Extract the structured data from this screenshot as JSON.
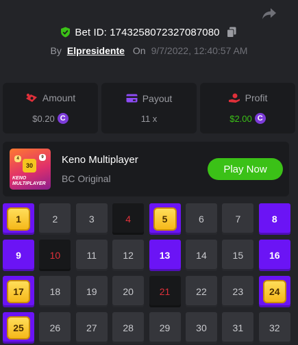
{
  "header": {
    "bet_id_label": "Bet ID: 1743258072327087080",
    "by_label": "By",
    "username": "Elpresidente",
    "on_label": "On",
    "datetime": "9/7/2022, 12:40:57 AM",
    "icons": {
      "share": "share-arrow-icon",
      "verified": "shield-check-icon",
      "copy": "copy-icon"
    },
    "colors": {
      "verified": "#3bc117"
    }
  },
  "stats": {
    "amount": {
      "label": "Amount",
      "value": "$0.20",
      "icon": "money-bag-icon",
      "coin": "C"
    },
    "payout": {
      "label": "Payout",
      "value": "11 x",
      "icon": "wallet-card-icon"
    },
    "profit": {
      "label": "Profit",
      "value": "$2.00",
      "icon": "hand-coin-icon",
      "coin": "C",
      "color": "#3bc117"
    }
  },
  "game": {
    "title": "Keno Multiplayer",
    "subtitle": "BC Original",
    "play_label": "Play Now",
    "thumb_text": "KENO MULTIPLAYER",
    "thumb_ball": "30",
    "thumb_ball_left": "4",
    "thumb_ball_right": "9"
  },
  "grid": {
    "accent": "#6b14f5",
    "hit_color": "#f5c520",
    "drawn_color": "#e0303a",
    "cells": [
      {
        "n": "1",
        "s": "hit"
      },
      {
        "n": "2",
        "s": "none"
      },
      {
        "n": "3",
        "s": "none"
      },
      {
        "n": "4",
        "s": "drawn"
      },
      {
        "n": "5",
        "s": "hit"
      },
      {
        "n": "6",
        "s": "none"
      },
      {
        "n": "7",
        "s": "none"
      },
      {
        "n": "8",
        "s": "picked"
      },
      {
        "n": "9",
        "s": "picked"
      },
      {
        "n": "10",
        "s": "drawn"
      },
      {
        "n": "11",
        "s": "none"
      },
      {
        "n": "12",
        "s": "none"
      },
      {
        "n": "13",
        "s": "picked"
      },
      {
        "n": "14",
        "s": "none"
      },
      {
        "n": "15",
        "s": "none"
      },
      {
        "n": "16",
        "s": "picked"
      },
      {
        "n": "17",
        "s": "hit"
      },
      {
        "n": "18",
        "s": "none"
      },
      {
        "n": "19",
        "s": "none"
      },
      {
        "n": "20",
        "s": "none"
      },
      {
        "n": "21",
        "s": "drawn"
      },
      {
        "n": "22",
        "s": "none"
      },
      {
        "n": "23",
        "s": "none"
      },
      {
        "n": "24",
        "s": "hit"
      },
      {
        "n": "25",
        "s": "hit"
      },
      {
        "n": "26",
        "s": "none"
      },
      {
        "n": "27",
        "s": "none"
      },
      {
        "n": "28",
        "s": "none"
      },
      {
        "n": "29",
        "s": "none"
      },
      {
        "n": "30",
        "s": "none"
      },
      {
        "n": "31",
        "s": "none"
      },
      {
        "n": "32",
        "s": "none"
      }
    ]
  }
}
